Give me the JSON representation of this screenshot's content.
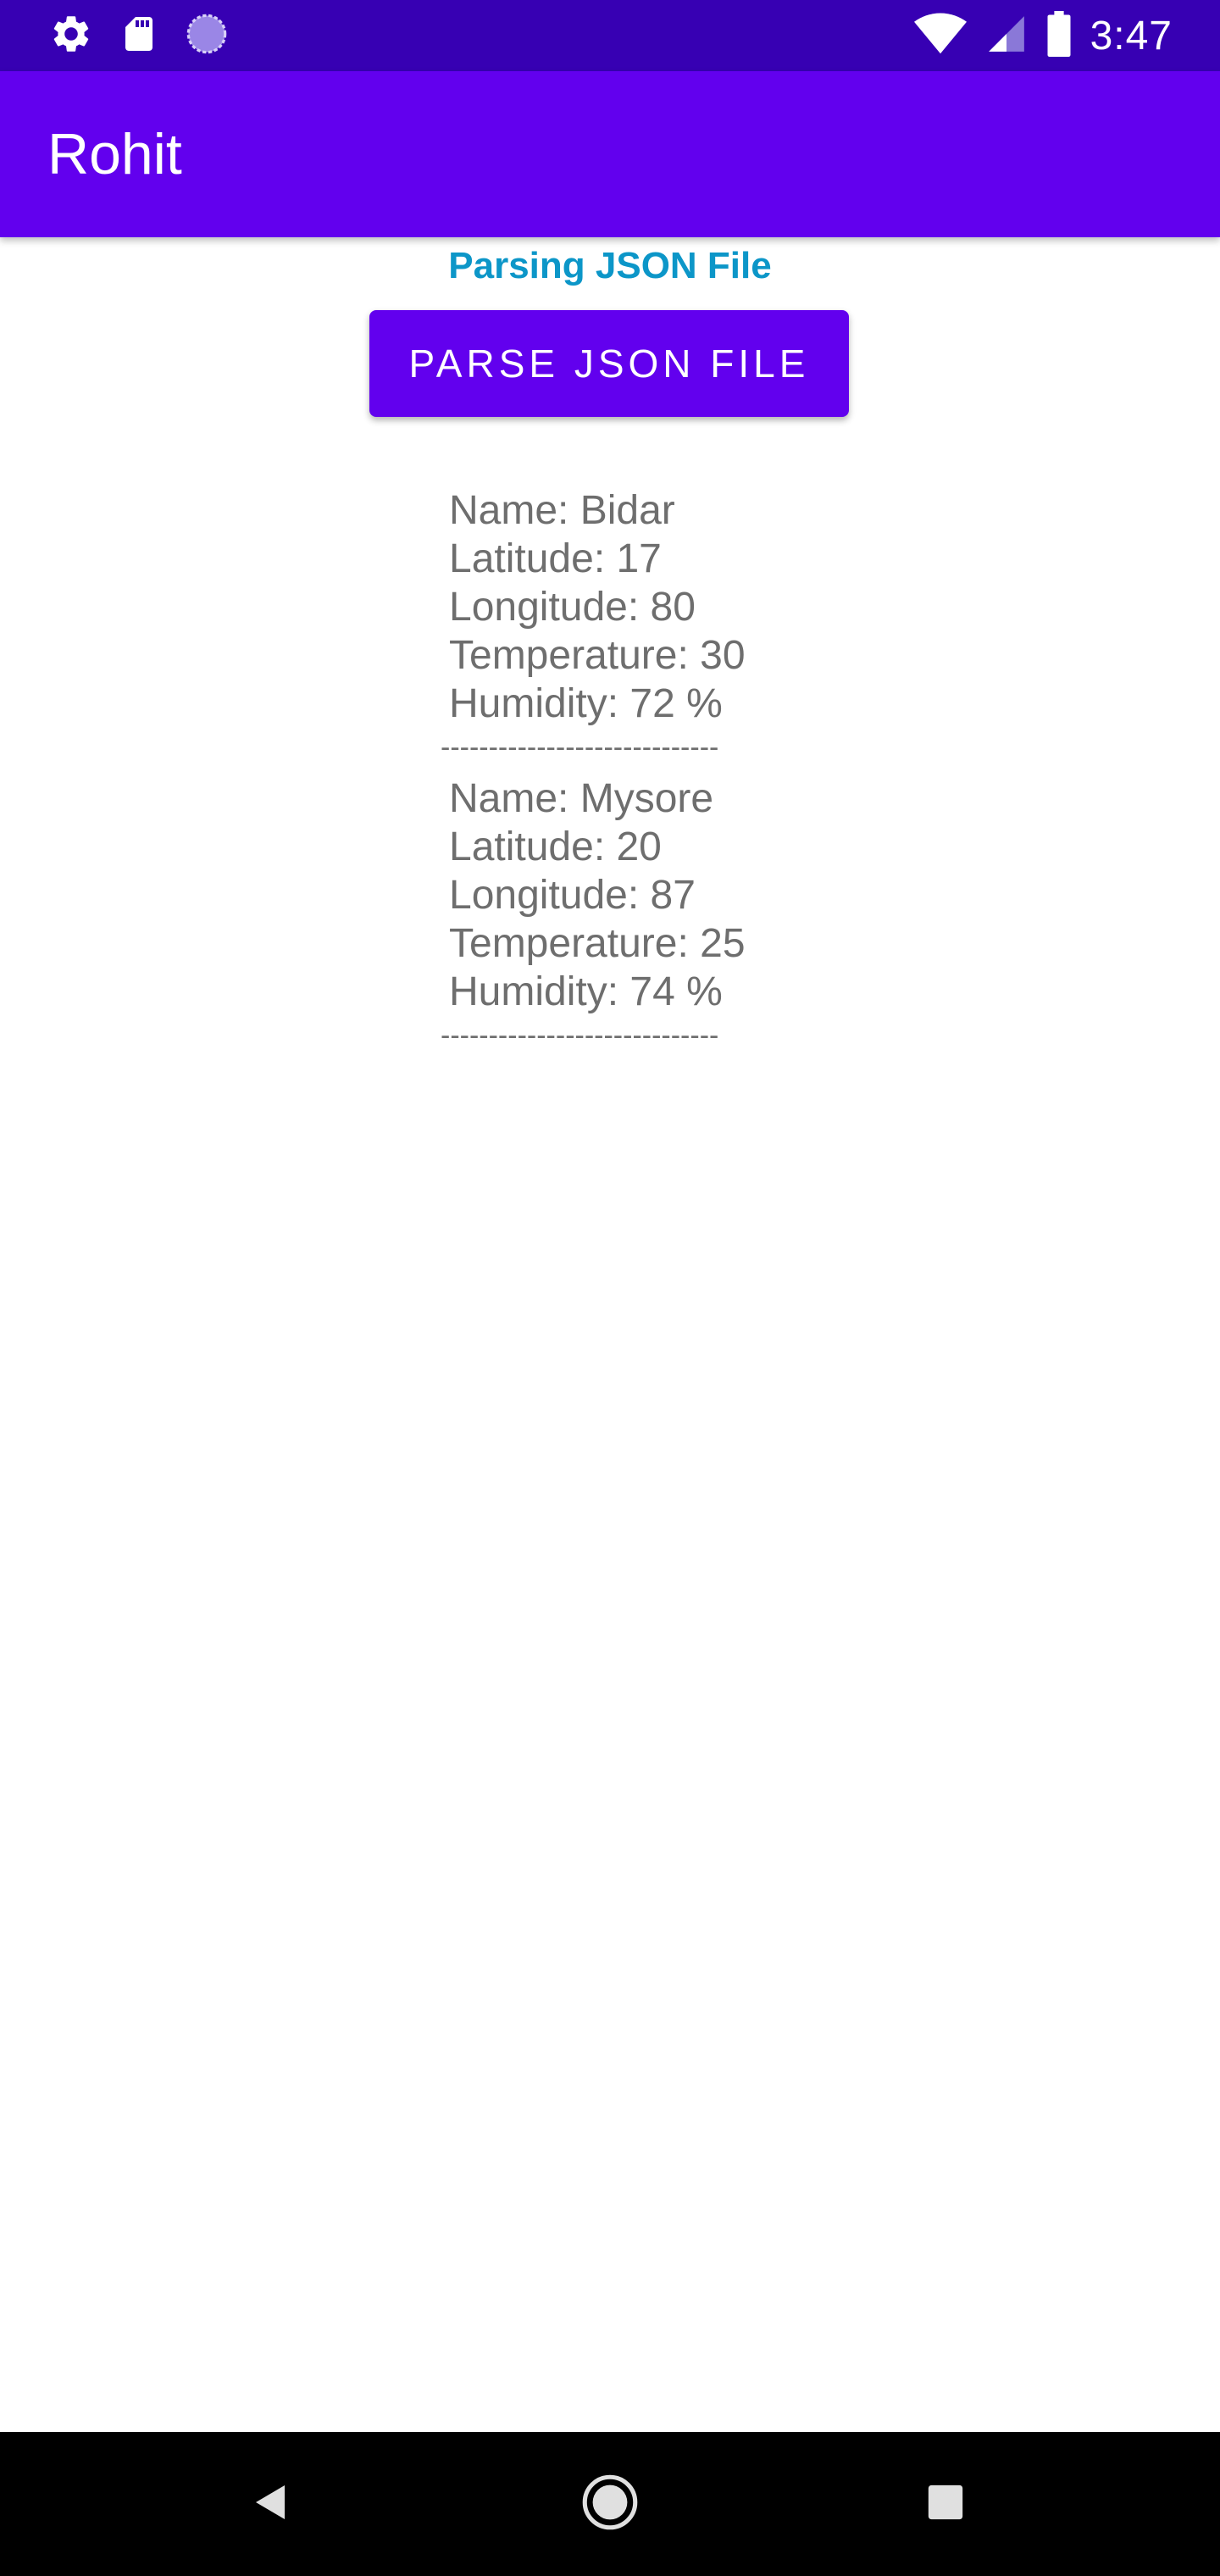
{
  "status_bar": {
    "time": "3:47",
    "left_icons": [
      "settings-icon",
      "sd-card-icon",
      "sync-loading-icon"
    ],
    "right_icons": [
      "wifi-icon",
      "cell-signal-icon",
      "battery-icon"
    ]
  },
  "app_bar": {
    "title": "Rohit",
    "color": "#6200ee"
  },
  "main": {
    "heading": "Parsing JSON File",
    "heading_color": "#0c96c8",
    "button_label": "PARSE JSON FILE",
    "records": [
      {
        "name": "Name: Bidar",
        "latitude": "Latitude: 17",
        "longitude": "Longitude: 80",
        "temperature": "Temperature: 30",
        "humidity": "Humidity: 72 %",
        "separator": "-----------------------------"
      },
      {
        "name": "Name: Mysore",
        "latitude": "Latitude: 20",
        "longitude": "Longitude: 87",
        "temperature": "Temperature: 25",
        "humidity": "Humidity: 74 %",
        "separator": "-----------------------------"
      }
    ]
  },
  "nav_bar": {
    "icons": [
      "back-icon",
      "home-icon",
      "recents-icon"
    ]
  },
  "colors": {
    "status_bar": "#3700b3",
    "primary": "#6200ee",
    "text_gray": "#6e6e6e"
  }
}
